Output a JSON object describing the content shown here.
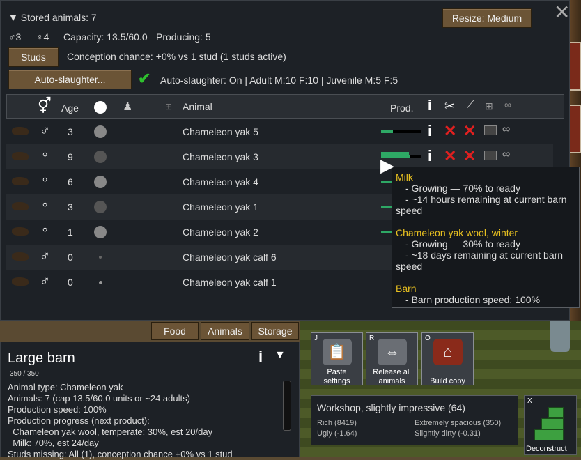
{
  "window": {
    "stored_title": "▼ Stored animals: 7",
    "male_count": "♂3",
    "female_count": "♀4",
    "capacity": "Capacity: 13.5/60.0",
    "producing": "Producing: 5",
    "resize_label": "Resize: Medium",
    "studs_label": "Studs",
    "conception_text": "Conception chance: +0% vs 1 stud (1 studs active)",
    "autoslaughter_label": "Auto-slaughter...",
    "autoslaughter_text": "Auto-slaughter: On | Adult M:10 F:10 | Juvenile M:5 F:5"
  },
  "table": {
    "headers": {
      "age": "Age",
      "animal": "Animal",
      "prod": "Prod."
    },
    "rows": [
      {
        "gender": "♂",
        "age": "3",
        "name": "Chameleon yak 5",
        "prod": 0.3,
        "dot": "large-light"
      },
      {
        "gender": "♀",
        "age": "9",
        "name": "Chameleon yak 3",
        "prod": 0.7,
        "dot": "large-dark"
      },
      {
        "gender": "♀",
        "age": "6",
        "name": "Chameleon yak 4",
        "prod": 0.3,
        "dot": "large-light"
      },
      {
        "gender": "♀",
        "age": "3",
        "name": "Chameleon yak 1",
        "prod": 0.3,
        "dot": "large-dark"
      },
      {
        "gender": "♀",
        "age": "1",
        "name": "Chameleon yak 2",
        "prod": 0.3,
        "dot": "large-light"
      },
      {
        "gender": "♂",
        "age": "0",
        "name": "Chameleon yak calf 6",
        "prod": null,
        "dot": "small"
      },
      {
        "gender": "♂",
        "age": "0",
        "name": "Chameleon yak calf 1",
        "prod": null,
        "dot": "small-light"
      }
    ]
  },
  "tooltip": {
    "milk_title": "Milk",
    "milk_l1": "- Growing — 70% to ready",
    "milk_l2": "- ~14 hours remaining at current barn",
    "milk_l3": "speed",
    "wool_title": "Chameleon yak wool, winter",
    "wool_l1": "- Growing — 30% to ready",
    "wool_l2": "- ~18 days remaining at current barn",
    "wool_l3": "speed",
    "barn_title": "Barn",
    "barn_l1": "- Barn production speed: 100%"
  },
  "tabs": [
    "Food",
    "Animals",
    "Storage"
  ],
  "info": {
    "title": "Large barn",
    "hp": "350 / 350",
    "hp_fraction": 1.0,
    "lines": [
      "Animal type: Chameleon yak",
      "Animals: 7 (cap 13.5/60.0 units or ~24 adults)",
      "Production speed: 100%",
      "Production progress (next product):",
      "  Chameleon yak wool, temperate: 30%, est 20/day",
      "  Milk: 70%, est 24/day",
      "Studs missing: All (1), conception chance +0% vs 1 stud"
    ]
  },
  "gizmos": [
    {
      "key": "J",
      "label1": "Paste",
      "label2": "settings"
    },
    {
      "key": "R",
      "label1": "Release all",
      "label2": "animals"
    },
    {
      "key": "O",
      "label1": "Build copy",
      "label2": ""
    }
  ],
  "workshop": {
    "title": "Workshop, slightly impressive (64)",
    "rich": "Rich (8419)",
    "ugly": "Ugly (-1.64)",
    "spacious": "Extremely spacious (350)",
    "dirty": "Slightly dirty (-0.31)"
  },
  "deconstruct": {
    "key": "X",
    "label": "Deconstruct"
  },
  "colors": {
    "accent": "#e8c020",
    "prod_bar": "#2ea865",
    "button": "#6b5436"
  }
}
